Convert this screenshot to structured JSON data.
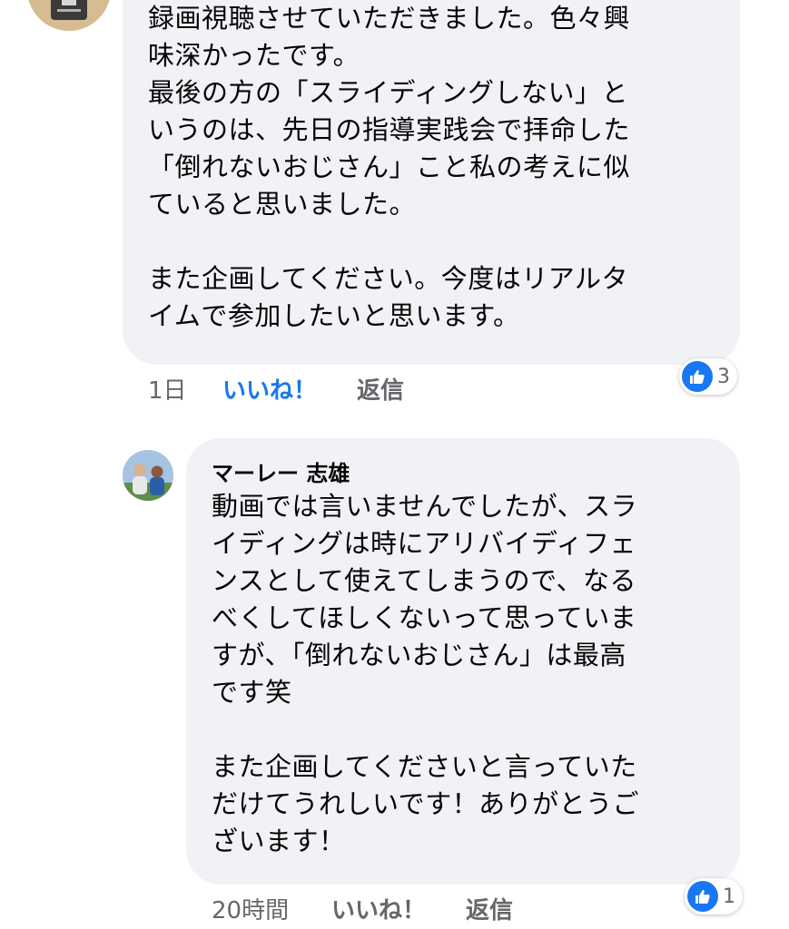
{
  "comment": {
    "lines": [
      "録画視聴させていただきました。色々興",
      "味深かったです。",
      "最後の方の「スライディングしない」と",
      "いうのは、先日の指導実践会で拝命した",
      "「倒れないおじさん」こと私の考えに似",
      "ていると思いました。",
      "",
      "また企画してください。今度はリアルタ",
      "イムで参加したいと思います。"
    ],
    "time": "1日",
    "like_label": "いいね！",
    "reply_label": "返信",
    "reaction_icon": "like-icon",
    "reaction_count": "3"
  },
  "reply": {
    "author": "マーレー 志雄",
    "lines": [
      "動画では言いませんでしたが、スラ",
      "イディングは時にアリバイディフェ",
      "ンスとして使えてしまうので、なる",
      "べくしてほしくないって思っていま",
      "すが、「倒れないおじさん」は最高",
      "です笑",
      "",
      "また企画してくださいと言っていた",
      "だけてうれしいです！ありがとうご",
      "ざいます！"
    ],
    "time": "20時間",
    "like_label": "いいね！",
    "reply_label": "返信",
    "reaction_icon": "like-icon",
    "reaction_count": "1"
  },
  "colors": {
    "bubble": "#f0f2f5",
    "like_blue": "#1877f2",
    "meta_gray": "#65676b",
    "text": "#050505"
  }
}
